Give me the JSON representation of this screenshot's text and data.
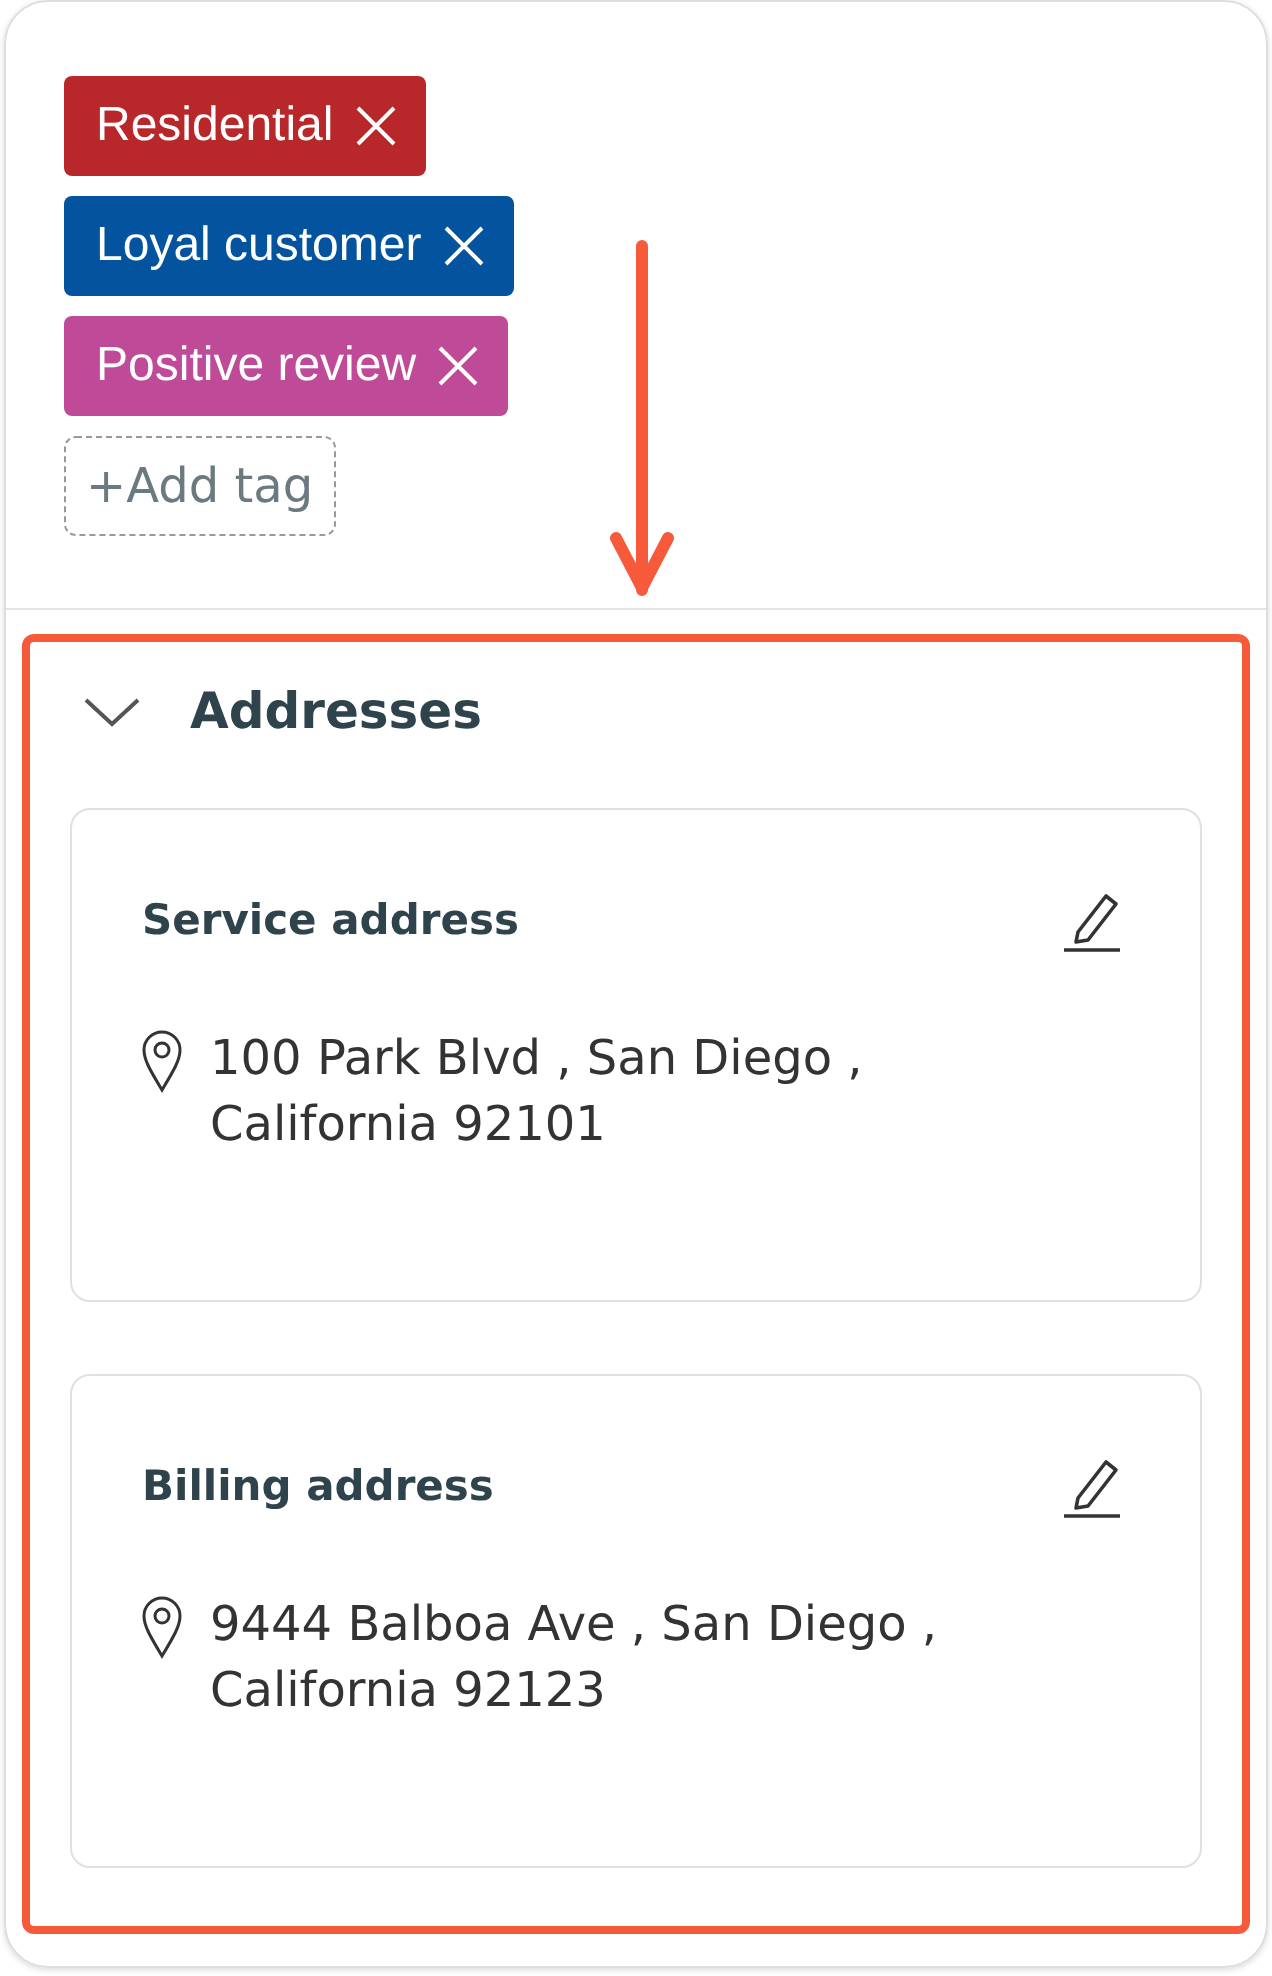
{
  "tags": [
    {
      "label": "Residential",
      "color": "#b8282a"
    },
    {
      "label": "Loyal customer",
      "color": "#03539e"
    },
    {
      "label": "Positive review",
      "color": "#bf4b98"
    }
  ],
  "add_tag": {
    "label": "+Add tag"
  },
  "addresses": {
    "title": "Addresses",
    "expanded": true,
    "cards": [
      {
        "title": "Service address",
        "address": "100 Park Blvd , San Diego , California 92101"
      },
      {
        "title": "Billing address",
        "address": "9444 Balboa Ave , San Diego , California 92123"
      }
    ]
  }
}
